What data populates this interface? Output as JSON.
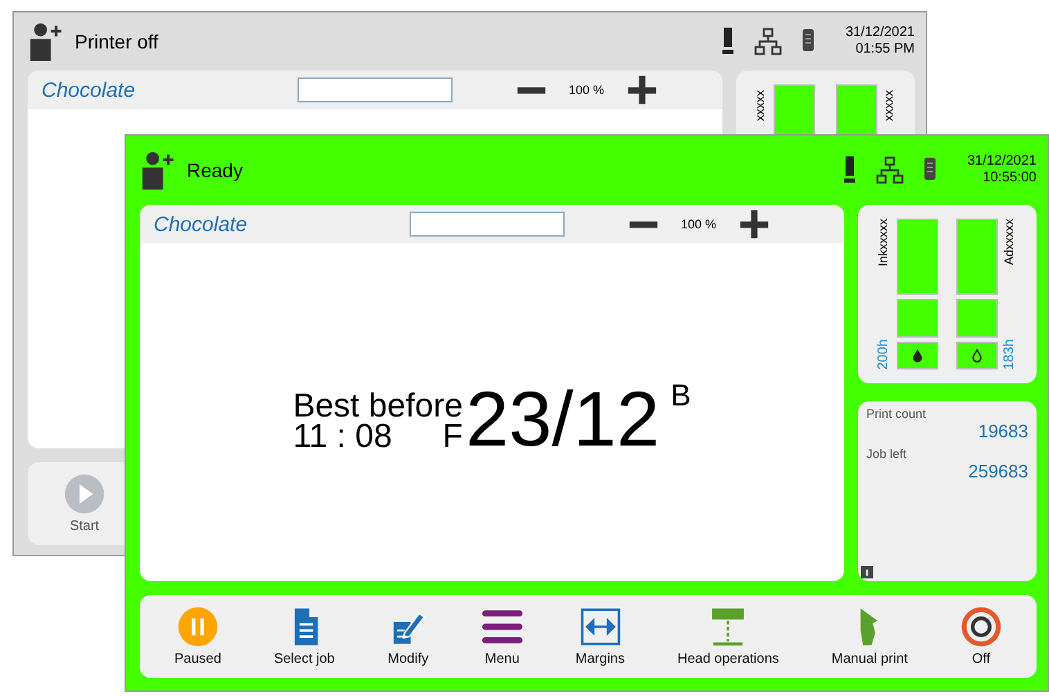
{
  "windows": [
    {
      "kind": "off",
      "status": "Printer off",
      "date": "31/12/2021",
      "time": "01:55 PM",
      "job_name": "Chocolate",
      "zoom": "100 %",
      "consumables": [
        {
          "label": "xxxxx"
        },
        {
          "label": "xxxxx"
        }
      ],
      "toolbar": [
        {
          "kind": "start",
          "label": "Start",
          "disabled": true
        }
      ]
    },
    {
      "kind": "ready",
      "status": "Ready",
      "date": "31/12/2021",
      "time": "10:55:00",
      "job_name": "Chocolate",
      "zoom": "100 %",
      "consumables": [
        {
          "kind": "ink",
          "label": "Inkxxxxx",
          "reading": "200h"
        },
        {
          "kind": "additive",
          "label": "Adxxxxx",
          "reading": "183h"
        }
      ],
      "label": {
        "caption": "Best before",
        "time": "11 : 08",
        "code_left": "F",
        "date": "23/12",
        "code_right": "B"
      },
      "counters": [
        {
          "label": "Print count",
          "value": "19683"
        },
        {
          "label": "Job left",
          "value": "259683"
        }
      ],
      "toolbar": [
        {
          "kind": "pause",
          "label": "Paused",
          "disabled": false
        },
        {
          "kind": "document",
          "label": "Select job",
          "disabled": false
        },
        {
          "kind": "edit",
          "label": "Modify",
          "disabled": false
        },
        {
          "kind": "menu",
          "label": "Menu",
          "disabled": false
        },
        {
          "kind": "margins",
          "label": "Margins",
          "disabled": false
        },
        {
          "kind": "head",
          "label": "Head operations",
          "disabled": false
        },
        {
          "kind": "hand",
          "label": "Manual print",
          "disabled": false
        },
        {
          "kind": "power",
          "label": "Off",
          "disabled": false
        }
      ]
    }
  ]
}
